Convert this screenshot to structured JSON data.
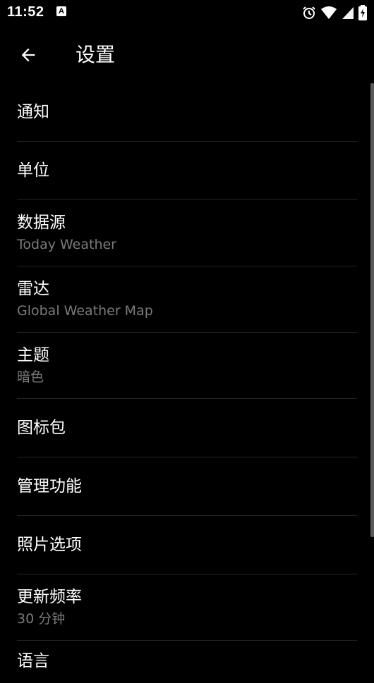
{
  "status_bar": {
    "time": "11:52",
    "notification_icon_letter": "A",
    "icons": [
      "a-app-icon",
      "alarm-icon",
      "wifi-icon",
      "signal-icon",
      "battery-icon"
    ]
  },
  "app_bar": {
    "title": "设置"
  },
  "settings": {
    "items": [
      {
        "title": "通知"
      },
      {
        "title": "单位"
      },
      {
        "title": "数据源",
        "summary": "Today Weather"
      },
      {
        "title": "雷达",
        "summary": "Global Weather Map"
      },
      {
        "title": "主题",
        "summary": "暗色"
      },
      {
        "title": "图标包"
      },
      {
        "title": "管理功能"
      },
      {
        "title": "照片选项"
      },
      {
        "title": "更新频率",
        "summary": "30 分钟"
      },
      {
        "title": "语言"
      }
    ]
  },
  "colors": {
    "background": "#000000",
    "text_primary": "#ffffff",
    "text_secondary": "#7a7a7a",
    "divider": "#262626",
    "scrollbar": "#5a5a5a"
  }
}
